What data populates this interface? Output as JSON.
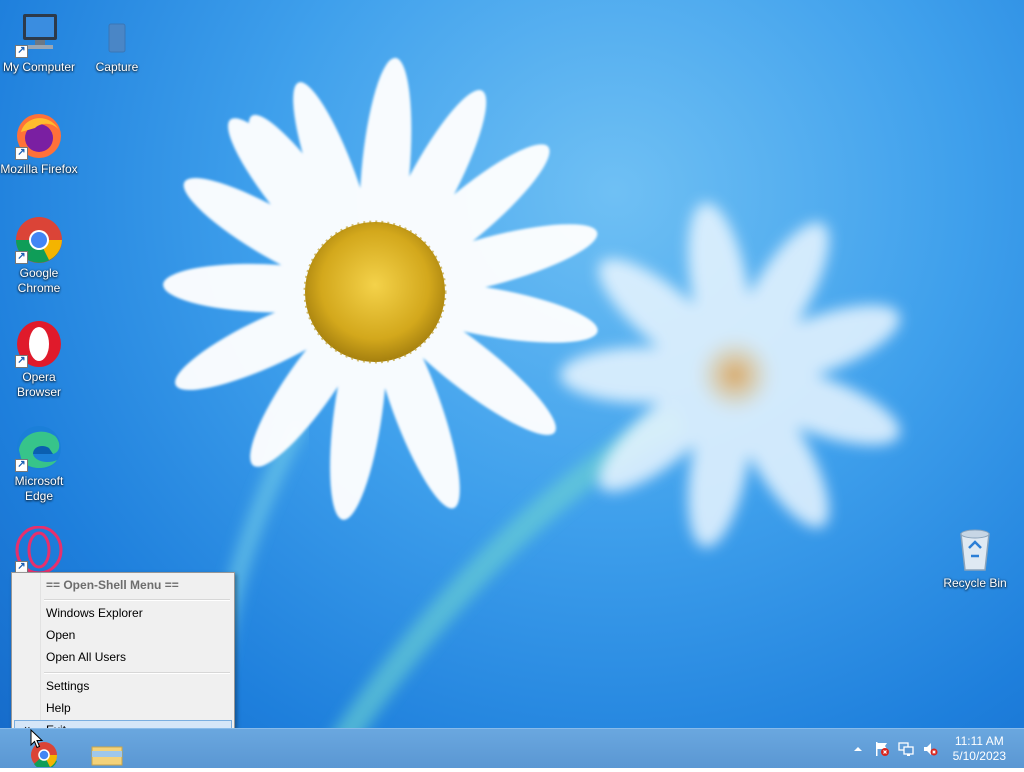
{
  "desktop": {
    "icons": [
      {
        "id": "my-computer",
        "label": "My Computer"
      },
      {
        "id": "capture",
        "label": "Capture"
      },
      {
        "id": "firefox",
        "label": "Mozilla Firefox"
      },
      {
        "id": "chrome",
        "label": "Google Chrome"
      },
      {
        "id": "opera",
        "label": "Opera Browser"
      },
      {
        "id": "edge",
        "label": "Microsoft Edge"
      },
      {
        "id": "opera-gx",
        "label": ""
      },
      {
        "id": "recycle-bin",
        "label": "Recycle Bin"
      }
    ]
  },
  "context_menu": {
    "items": [
      {
        "label": "== Open-Shell Menu ==",
        "type": "header"
      },
      {
        "label": "Windows Explorer"
      },
      {
        "label": "Open"
      },
      {
        "label": "Open All Users"
      },
      {
        "label": "Settings"
      },
      {
        "label": "Help"
      },
      {
        "label": "Exit",
        "hovered": true,
        "glyph": "×"
      }
    ]
  },
  "taskbar": {
    "clock": {
      "time": "11:11 AM",
      "date": "5/10/2023"
    },
    "tray": [
      "chevron-up-icon",
      "flag-icon",
      "network-icon",
      "volume-muted-icon"
    ]
  },
  "colors": {
    "accent": "#1e7fdc",
    "taskbar": "#5a97d3",
    "menu_hover": "#d5e6f8"
  }
}
